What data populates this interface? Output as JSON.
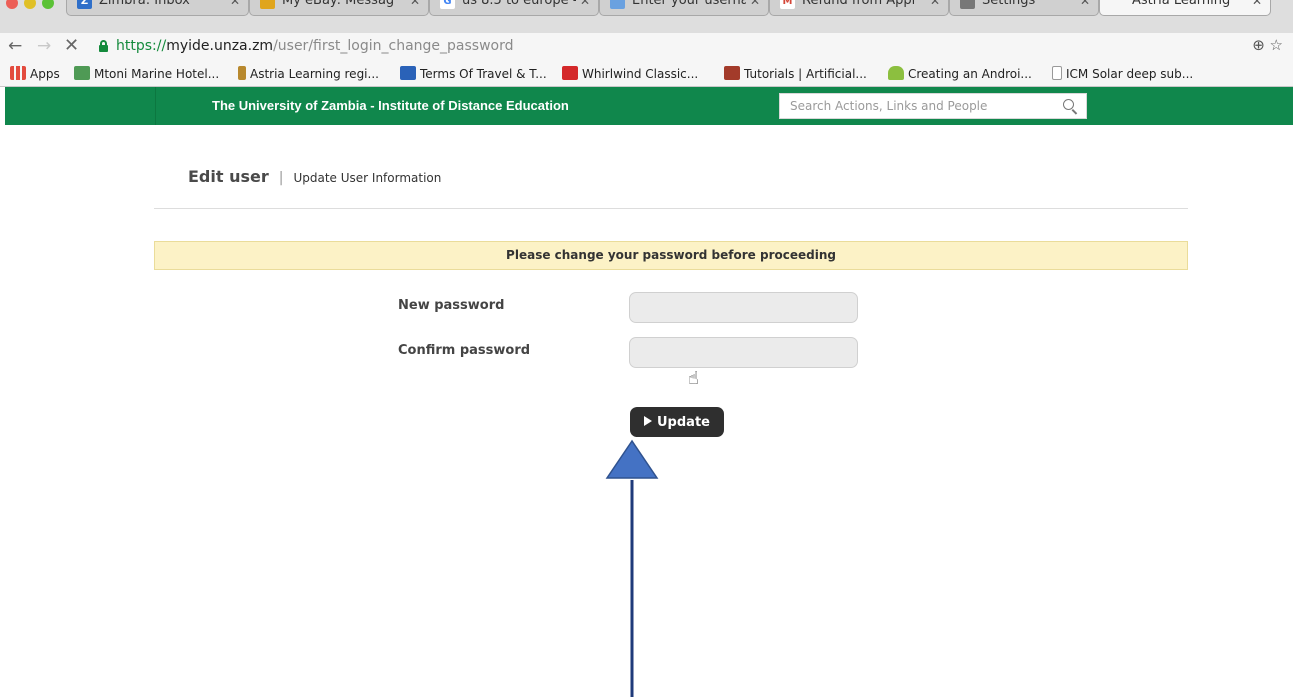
{
  "browser": {
    "tabs": [
      {
        "title": "Zimbra: Inbox",
        "favicon_color": "#2f6fc9",
        "favicon_letter": "Z",
        "close": "✕"
      },
      {
        "title": "My eBay: Messag",
        "favicon_color": "#e0a51c",
        "favicon_letter": "",
        "close": "✕"
      },
      {
        "title": "us 8.5 to europe -",
        "favicon_color": "#4285f4",
        "favicon_letter": "G",
        "close": "✕"
      },
      {
        "title": "Enter your usernam",
        "favicon_color": "#6aa1e0",
        "favicon_letter": "",
        "close": "✕"
      },
      {
        "title": "Refund from Appl",
        "favicon_color": "#d44638",
        "favicon_letter": "M",
        "close": "✕"
      },
      {
        "title": "Settings",
        "favicon_color": "#777777",
        "favicon_letter": "",
        "close": "✕"
      },
      {
        "title": "Astria Learning",
        "favicon_color": "#f6f6f6",
        "favicon_letter": "",
        "close": "✕",
        "active": true
      }
    ],
    "address": {
      "scheme": "https://",
      "host": "myide.unza.zm",
      "path": "/user/first_login_change_password"
    },
    "nav": {
      "back": "←",
      "forward": "→",
      "stop": "✕"
    },
    "bookmarks": [
      {
        "label": "Apps",
        "icon_color": "#e34b3e"
      },
      {
        "label": "Mtoni Marine Hotel...",
        "icon_color": "#4f9a55"
      },
      {
        "label": "Astria Learning regi...",
        "icon_color": "#b8892e"
      },
      {
        "label": "Terms Of Travel & T...",
        "icon_color": "#2a62b8"
      },
      {
        "label": "Whirlwind Classic...",
        "icon_color": "#d4282a"
      },
      {
        "label": "Tutorials | Artificial...",
        "icon_color": "#a33b2a"
      },
      {
        "label": "Creating an Androi...",
        "icon_color": "#8cbf3f"
      },
      {
        "label": "ICM Solar deep sub...",
        "icon_color": "#ffffff"
      }
    ]
  },
  "header": {
    "site_title": "The University of Zambia - Institute of Distance Education",
    "search_placeholder": "Search Actions, Links and People",
    "bg_color": "#10874c"
  },
  "page": {
    "title": "Edit user",
    "separator": "|",
    "subtitle": "Update User Information",
    "notice": "Please change your password before proceeding",
    "form": {
      "new_password_label": "New password",
      "confirm_password_label": "Confirm password",
      "new_password_value": "",
      "confirm_password_value": ""
    },
    "update_button_label": "Update"
  },
  "annotation": {
    "arrow_color": "#4472c4"
  }
}
